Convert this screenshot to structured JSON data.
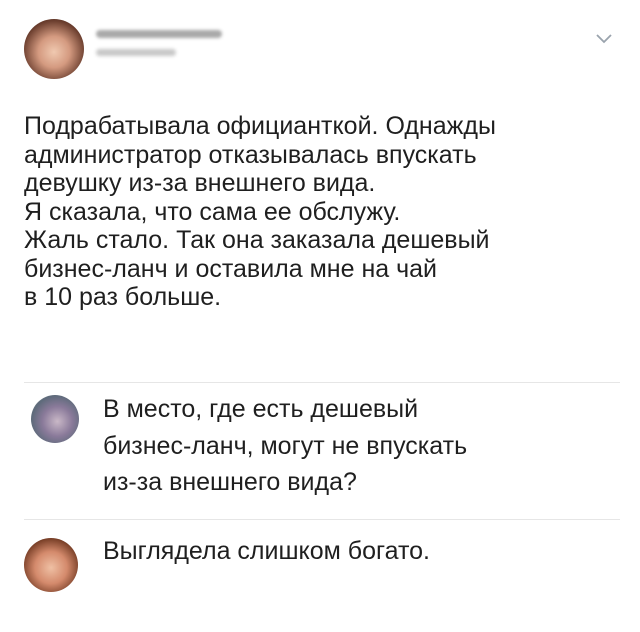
{
  "post": {
    "author_name": "",
    "author_handle": "",
    "text": "Подрабатывала официанткой. Однажды\nадминистратор отказывалась впускать\nдевушку из-за внешнего вида.\nЯ сказала, что сама ее обслужу.\nЖаль стало. Так она заказала дешевый\nбизнес-ланч и оставила мне на чай\nв 10 раз больше."
  },
  "comments": [
    {
      "text": "В место, где есть дешевый\nбизнес-ланч, могут не впускать\nиз-за внешнего вида?"
    },
    {
      "text": "Выглядела слишком богато."
    }
  ],
  "icons": {
    "menu": "chevron-down-icon"
  },
  "colors": {
    "text": "#1f1f1f",
    "divider": "#e6e6e6",
    "chevron": "#9aa3ad"
  }
}
